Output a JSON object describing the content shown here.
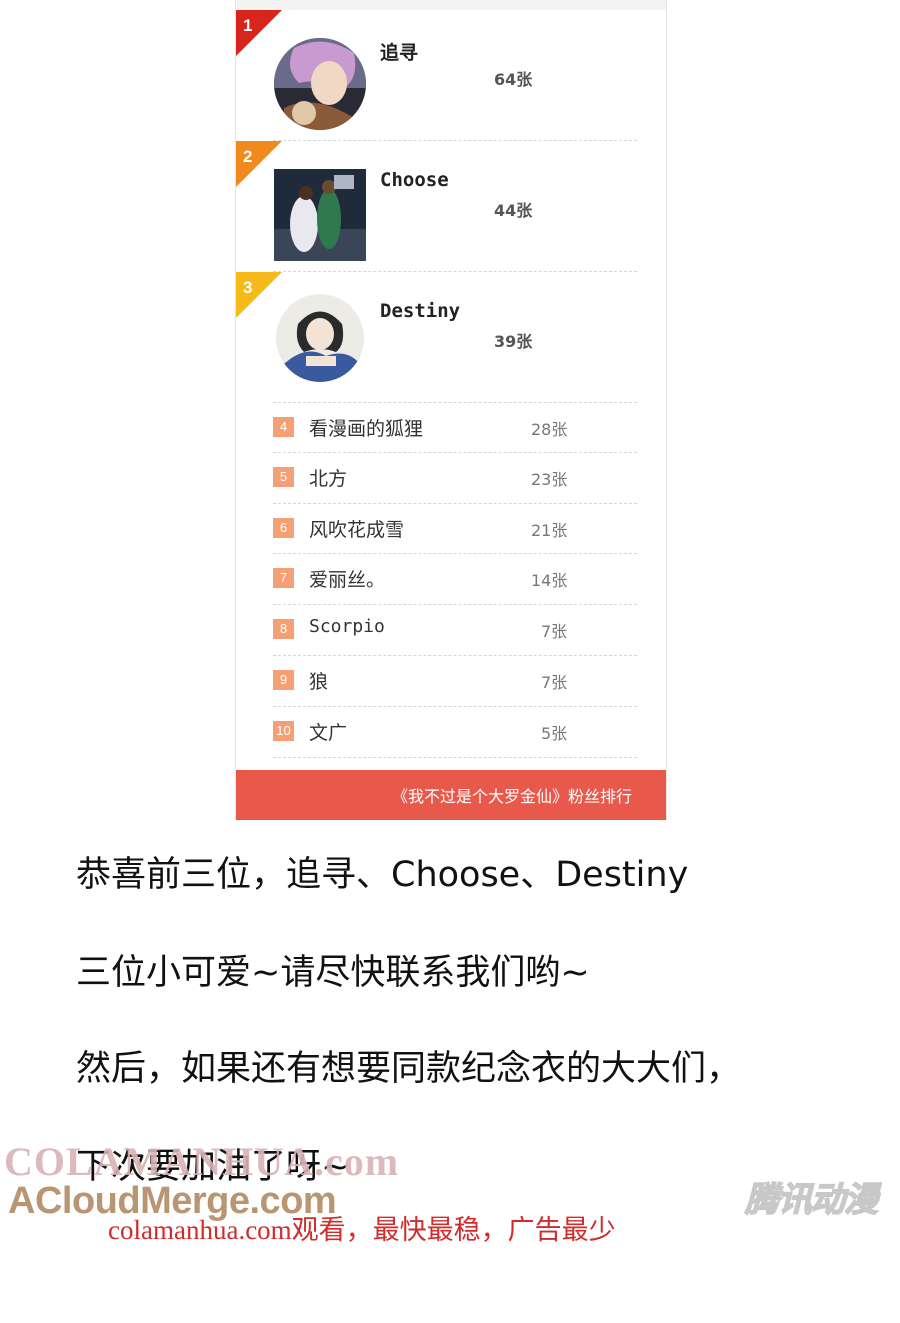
{
  "ranking": {
    "top": [
      {
        "rank": "1",
        "name": "追寻",
        "count": "64张",
        "color": "#d9261c",
        "avatar": "anime-portrait"
      },
      {
        "rank": "2",
        "name": "Choose",
        "count": "44张",
        "color": "#f08a1e",
        "avatar": "basketball-photo"
      },
      {
        "rank": "3",
        "name": "Destiny",
        "count": "39张",
        "color": "#f5b91a",
        "avatar": "anime-sketch-portrait"
      }
    ],
    "rest": [
      {
        "rank": "4",
        "name": "看漫画的狐狸",
        "count": "28张"
      },
      {
        "rank": "5",
        "name": "北方",
        "count": "23张"
      },
      {
        "rank": "6",
        "name": "风吹花成雪",
        "count": "21张"
      },
      {
        "rank": "7",
        "name": "爱丽丝。",
        "count": "14张"
      },
      {
        "rank": "8",
        "name": "Scorpio",
        "count": "7张"
      },
      {
        "rank": "9",
        "name": "狼",
        "count": "7张"
      },
      {
        "rank": "10",
        "name": "文广",
        "count": "5张"
      }
    ],
    "footer": "《我不过是个大罗金仙》粉丝排行"
  },
  "text_lines": [
    "恭喜前三位，追寻、Choose、Destiny",
    "三位小可爱~请尽快联系我们哟~",
    "然后，如果还有想要同款纪念衣的大大们，",
    "下次要加油了呀~"
  ],
  "watermarks": {
    "colamanhua": "COLAMANHUA.com",
    "acloud": "ACloudMerge.com",
    "notice": "colamanhua.com观看，最快最稳，广告最少",
    "logo": "腾讯动漫"
  }
}
